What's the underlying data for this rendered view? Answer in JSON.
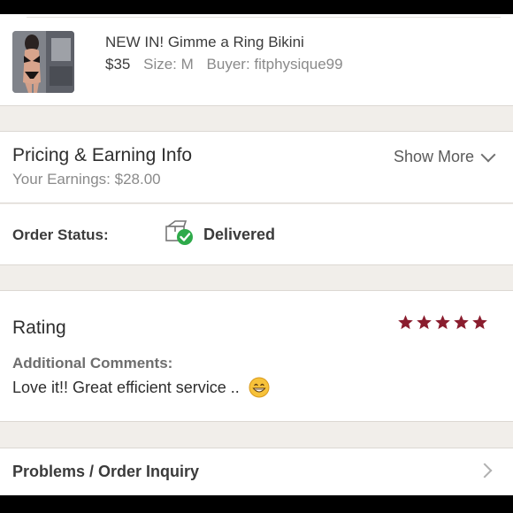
{
  "item": {
    "title": "NEW IN! Gimme a Ring Bikini",
    "price": "$35",
    "size": "Size: M",
    "buyer": "Buyer: fitphysique99",
    "thumbnail_icon": "bikini-photo"
  },
  "pricing": {
    "title": "Pricing & Earning Info",
    "earnings": "Your Earnings: $28.00",
    "show_more_label": "Show More",
    "show_more_icon": "chevron-down-icon"
  },
  "order_status": {
    "label": "Order Status:",
    "value": "Delivered",
    "icon": "delivered-box-check-icon",
    "check_color": "#2eaa4a"
  },
  "rating": {
    "title": "Rating",
    "stars": 5,
    "star_color": "#8a1d2e",
    "comments_label": "Additional Comments:",
    "comments_text": "Love it!! Great efficient service ..",
    "emoji": "grinning-face-emoji"
  },
  "problems": {
    "label": "Problems / Order Inquiry",
    "icon": "chevron-right-icon"
  },
  "colors": {
    "background": "#f1eeea",
    "panel": "#ffffff",
    "separator": "#dcd8d3"
  }
}
